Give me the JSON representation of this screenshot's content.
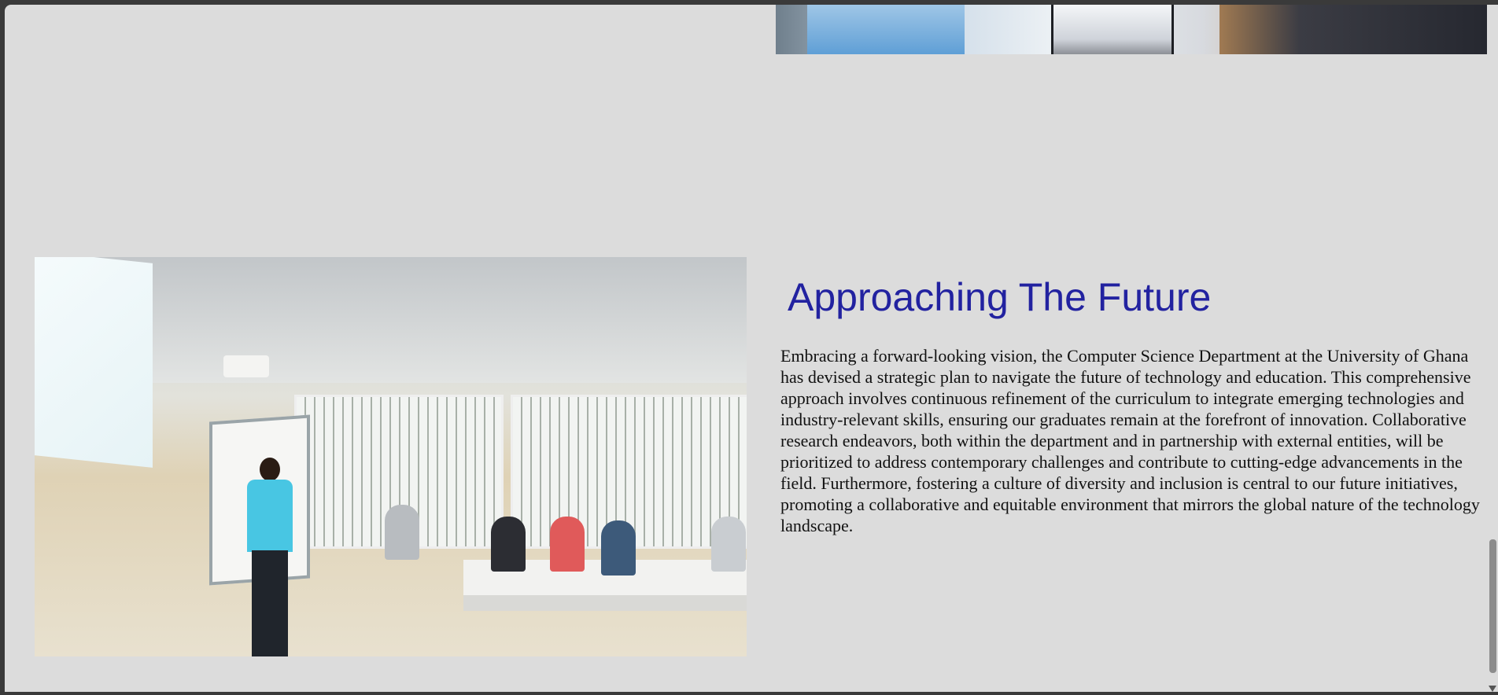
{
  "section": {
    "title": "Approaching The Future",
    "body": "Embracing a forward-looking vision, the Computer Science Department at the University of Ghana has devised a strategic plan to navigate the future of technology and education. This comprehensive approach involves continuous refinement of the curriculum to integrate emerging technologies and industry-relevant skills, ensuring our graduates remain at the forefront of innovation. Collaborative research endeavors, both within the department and in partnership with external entities, will be prioritized to address contemporary challenges and contribute to cutting-edge advancements in the field. Furthermore, fostering a culture of diversity and inclusion is central to our future initiatives, promoting a collaborative and equitable environment that mirrors the global nature of the technology landscape."
  },
  "colors": {
    "page_background": "#dcdcdc",
    "heading": "#2222a0",
    "body_text": "#111111"
  },
  "icons": {
    "scroll_down": "scroll-down-arrow-icon"
  }
}
